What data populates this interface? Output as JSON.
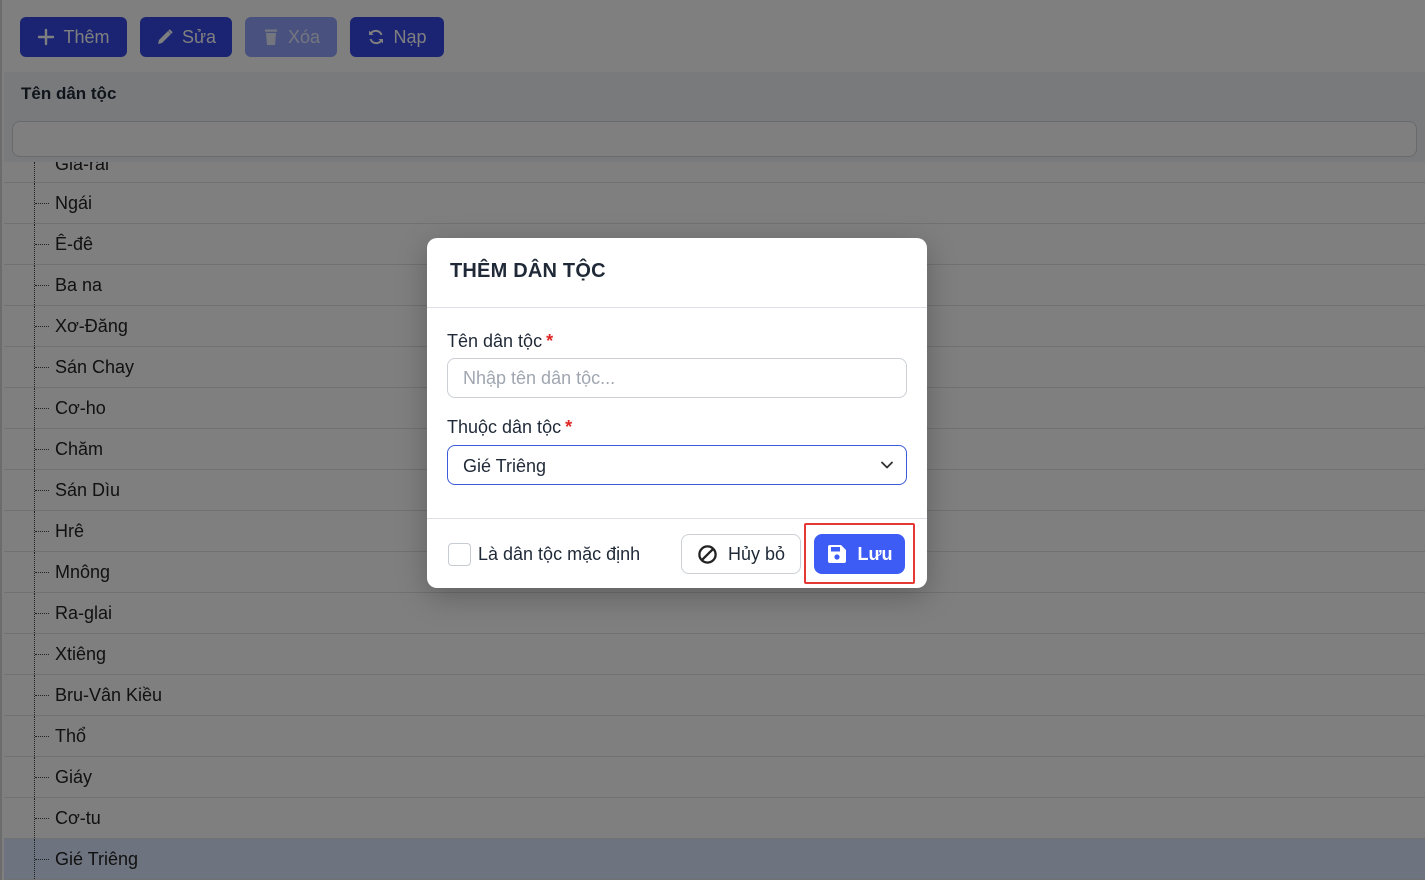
{
  "toolbar": {
    "add_label": "Thêm",
    "edit_label": "Sửa",
    "delete_label": "Xóa",
    "reload_label": "Nạp"
  },
  "grid": {
    "column_header": "Tên dân tộc",
    "filter_value": "",
    "rows": [
      "Gia-rai",
      "Ngái",
      "Ê-đê",
      "Ba na",
      "Xơ-Đăng",
      "Sán Chay",
      "Cơ-ho",
      "Chăm",
      "Sán Dìu",
      "Hrê",
      "Mnông",
      "Ra-glai",
      "Xtiêng",
      "Bru-Vân Kiều",
      "Thổ",
      "Giáy",
      "Cơ-tu",
      "Gié Triêng"
    ],
    "selected_row": "Gié Triêng"
  },
  "modal": {
    "title": "THÊM DÂN TỘC",
    "name_label": "Tên dân tộc",
    "name_placeholder": "Nhập tên dân tộc...",
    "name_value": "",
    "parent_label": "Thuộc dân tộc",
    "parent_value": "Gié Triêng",
    "required_mark": "*",
    "default_checkbox_label": "Là dân tộc mặc định",
    "default_checked": false,
    "cancel_label": "Hủy bỏ",
    "save_label": "Lưu"
  },
  "colors": {
    "primary": "#3548e6",
    "save": "#3d5cf5",
    "required": "#e02424",
    "highlight": "#e53935"
  },
  "icons": {
    "add": "plus-icon",
    "edit": "pencil-icon",
    "delete": "trash-icon",
    "reload": "refresh-icon",
    "cancel": "ban-icon",
    "save": "floppy-disk-icon",
    "dropdown": "chevron-down-icon"
  }
}
